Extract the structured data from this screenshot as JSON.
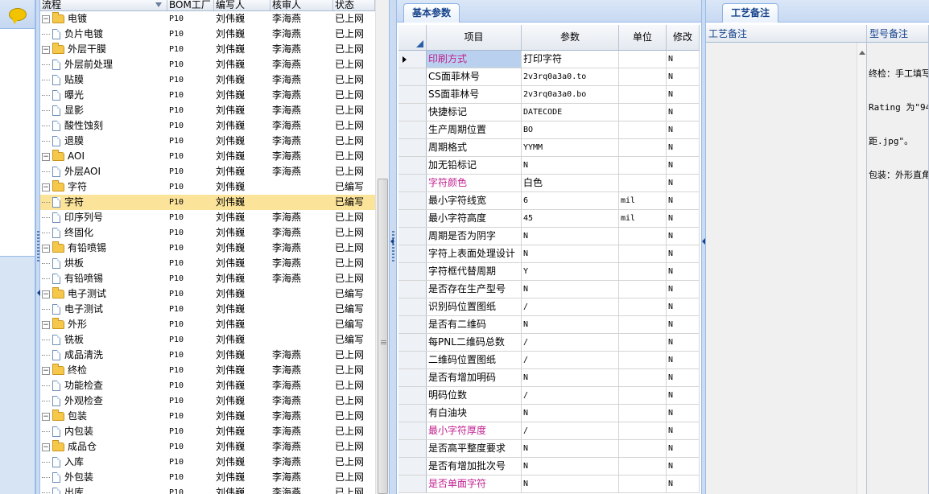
{
  "tree": {
    "columns": [
      "流程",
      "BOM工厂",
      "编写人",
      "核审人",
      "状态"
    ],
    "rows": [
      {
        "level": 0,
        "expanded": true,
        "name": "电镀",
        "bom": "P10",
        "author": "刘伟巍",
        "reviewer": "李海燕",
        "status": "已上网"
      },
      {
        "level": 1,
        "name": "负片电镀",
        "bom": "P10",
        "author": "刘伟巍",
        "reviewer": "李海燕",
        "status": "已上网"
      },
      {
        "level": 0,
        "expanded": true,
        "name": "外层干膜",
        "bom": "P10",
        "author": "刘伟巍",
        "reviewer": "李海燕",
        "status": "已上网"
      },
      {
        "level": 1,
        "name": "外层前处理",
        "bom": "P10",
        "author": "刘伟巍",
        "reviewer": "李海燕",
        "status": "已上网"
      },
      {
        "level": 1,
        "name": "贴膜",
        "bom": "P10",
        "author": "刘伟巍",
        "reviewer": "李海燕",
        "status": "已上网"
      },
      {
        "level": 1,
        "name": "曝光",
        "bom": "P10",
        "author": "刘伟巍",
        "reviewer": "李海燕",
        "status": "已上网"
      },
      {
        "level": 1,
        "name": "显影",
        "bom": "P10",
        "author": "刘伟巍",
        "reviewer": "李海燕",
        "status": "已上网"
      },
      {
        "level": 1,
        "name": "酸性蚀刻",
        "bom": "P10",
        "author": "刘伟巍",
        "reviewer": "李海燕",
        "status": "已上网"
      },
      {
        "level": 1,
        "name": "退膜",
        "bom": "P10",
        "author": "刘伟巍",
        "reviewer": "李海燕",
        "status": "已上网"
      },
      {
        "level": 0,
        "expanded": true,
        "name": "AOI",
        "bom": "P10",
        "author": "刘伟巍",
        "reviewer": "李海燕",
        "status": "已上网"
      },
      {
        "level": 1,
        "name": "外层AOI",
        "bom": "P10",
        "author": "刘伟巍",
        "reviewer": "李海燕",
        "status": "已上网"
      },
      {
        "level": 0,
        "expanded": true,
        "name": "字符",
        "bom": "P10",
        "author": "刘伟巍",
        "reviewer": "",
        "status": "已编写"
      },
      {
        "level": 1,
        "name": "字符",
        "bom": "P10",
        "author": "刘伟巍",
        "reviewer": "",
        "status": "已编写",
        "selected": true
      },
      {
        "level": 1,
        "name": "印序列号",
        "bom": "P10",
        "author": "刘伟巍",
        "reviewer": "李海燕",
        "status": "已上网"
      },
      {
        "level": 1,
        "name": "终固化",
        "bom": "P10",
        "author": "刘伟巍",
        "reviewer": "李海燕",
        "status": "已上网"
      },
      {
        "level": 0,
        "expanded": true,
        "name": "有铅喷锡",
        "bom": "P10",
        "author": "刘伟巍",
        "reviewer": "李海燕",
        "status": "已上网"
      },
      {
        "level": 1,
        "name": "烘板",
        "bom": "P10",
        "author": "刘伟巍",
        "reviewer": "李海燕",
        "status": "已上网"
      },
      {
        "level": 1,
        "name": "有铅喷锡",
        "bom": "P10",
        "author": "刘伟巍",
        "reviewer": "李海燕",
        "status": "已上网"
      },
      {
        "level": 0,
        "expanded": true,
        "name": "电子测试",
        "bom": "P10",
        "author": "刘伟巍",
        "reviewer": "",
        "status": "已编写"
      },
      {
        "level": 1,
        "name": "电子测试",
        "bom": "P10",
        "author": "刘伟巍",
        "reviewer": "",
        "status": "已编写"
      },
      {
        "level": 0,
        "expanded": true,
        "name": "外形",
        "bom": "P10",
        "author": "刘伟巍",
        "reviewer": "",
        "status": "已编写"
      },
      {
        "level": 1,
        "name": "铣板",
        "bom": "P10",
        "author": "刘伟巍",
        "reviewer": "",
        "status": "已编写"
      },
      {
        "level": 1,
        "name": "成品清洗",
        "bom": "P10",
        "author": "刘伟巍",
        "reviewer": "李海燕",
        "status": "已上网"
      },
      {
        "level": 0,
        "expanded": true,
        "name": "终检",
        "bom": "P10",
        "author": "刘伟巍",
        "reviewer": "李海燕",
        "status": "已上网"
      },
      {
        "level": 1,
        "name": "功能检查",
        "bom": "P10",
        "author": "刘伟巍",
        "reviewer": "李海燕",
        "status": "已上网"
      },
      {
        "level": 1,
        "name": "外观检查",
        "bom": "P10",
        "author": "刘伟巍",
        "reviewer": "李海燕",
        "status": "已上网"
      },
      {
        "level": 0,
        "expanded": true,
        "name": "包装",
        "bom": "P10",
        "author": "刘伟巍",
        "reviewer": "李海燕",
        "status": "已上网"
      },
      {
        "level": 1,
        "name": "内包装",
        "bom": "P10",
        "author": "刘伟巍",
        "reviewer": "李海燕",
        "status": "已上网"
      },
      {
        "level": 0,
        "expanded": true,
        "name": "成品仓",
        "bom": "P10",
        "author": "刘伟巍",
        "reviewer": "李海燕",
        "status": "已上网"
      },
      {
        "level": 1,
        "name": "入库",
        "bom": "P10",
        "author": "刘伟巍",
        "reviewer": "李海燕",
        "status": "已上网"
      },
      {
        "level": 1,
        "name": "外包装",
        "bom": "P10",
        "author": "刘伟巍",
        "reviewer": "李海燕",
        "status": "已上网"
      },
      {
        "level": 1,
        "name": "出库",
        "bom": "P10",
        "author": "刘伟巍",
        "reviewer": "李海燕",
        "status": "已上网"
      }
    ]
  },
  "params": {
    "tab": "基本参数",
    "columns": [
      "项目",
      "参数",
      "单位",
      "修改"
    ],
    "rows": [
      {
        "item": "印刷方式",
        "value": "打印字符",
        "unit": "",
        "mod": "N",
        "pink": true,
        "current": true
      },
      {
        "item": "CS面菲林号",
        "value": "2v3rq0a3a0.to",
        "unit": "",
        "mod": "N",
        "mono": true
      },
      {
        "item": "SS面菲林号",
        "value": "2v3rq0a3a0.bo",
        "unit": "",
        "mod": "N",
        "mono": true
      },
      {
        "item": "快捷标记",
        "value": "DATECODE",
        "unit": "",
        "mod": "N",
        "mono": true
      },
      {
        "item": "生产周期位置",
        "value": "BO",
        "unit": "",
        "mod": "N",
        "mono": true
      },
      {
        "item": "周期格式",
        "value": "YYMM",
        "unit": "",
        "mod": "N",
        "mono": true
      },
      {
        "item": "加无铅标记",
        "value": "N",
        "unit": "",
        "mod": "N",
        "mono": true
      },
      {
        "item": "字符颜色",
        "value": "白色",
        "unit": "",
        "mod": "N",
        "pink": true
      },
      {
        "item": "最小字符线宽",
        "value": "6",
        "unit": "mil",
        "mod": "N",
        "mono": true
      },
      {
        "item": "最小字符高度",
        "value": "45",
        "unit": "mil",
        "mod": "N",
        "mono": true
      },
      {
        "item": "周期是否为阴字",
        "value": "N",
        "unit": "",
        "mod": "N",
        "mono": true
      },
      {
        "item": "字符上表面处理设计",
        "value": "N",
        "unit": "",
        "mod": "N",
        "mono": true
      },
      {
        "item": "字符框代替周期",
        "value": "Y",
        "unit": "",
        "mod": "N",
        "mono": true
      },
      {
        "item": "是否存在生产型号",
        "value": "N",
        "unit": "",
        "mod": "N",
        "mono": true
      },
      {
        "item": "识别码位置图纸",
        "value": "/",
        "unit": "",
        "mod": "N",
        "mono": true
      },
      {
        "item": "是否有二维码",
        "value": "N",
        "unit": "",
        "mod": "N",
        "mono": true
      },
      {
        "item": "每PNL二维码总数",
        "value": "/",
        "unit": "",
        "mod": "N",
        "mono": true
      },
      {
        "item": "二维码位置图纸",
        "value": "/",
        "unit": "",
        "mod": "N",
        "mono": true
      },
      {
        "item": "是否有增加明码",
        "value": "N",
        "unit": "",
        "mod": "N",
        "mono": true
      },
      {
        "item": "明码位数",
        "value": "/",
        "unit": "",
        "mod": "N",
        "mono": true
      },
      {
        "item": "有白油块",
        "value": "N",
        "unit": "",
        "mod": "N",
        "mono": true
      },
      {
        "item": "最小字符厚度",
        "value": "/",
        "unit": "",
        "mod": "N",
        "pink": true,
        "mono": true
      },
      {
        "item": "是否高平整度要求",
        "value": "N",
        "unit": "",
        "mod": "N",
        "mono": true
      },
      {
        "item": "是否有增加批次号",
        "value": "N",
        "unit": "",
        "mod": "N",
        "mono": true
      },
      {
        "item": "是否单面字符",
        "value": "N",
        "unit": "",
        "mod": "N",
        "pink": true,
        "mono": true
      }
    ]
  },
  "notes": {
    "tab": "工艺备注",
    "process_header": "工艺备注",
    "model_header": "型号备注",
    "model_text_lines": [
      "终检：手工填写",
      "Rating 为\"94",
      "距.jpg\"。",
      "包装：外形直角"
    ]
  },
  "colors": {
    "selected_row": "#fbe39a",
    "pink_label": "#c0208f",
    "header_text": "#15428b"
  }
}
